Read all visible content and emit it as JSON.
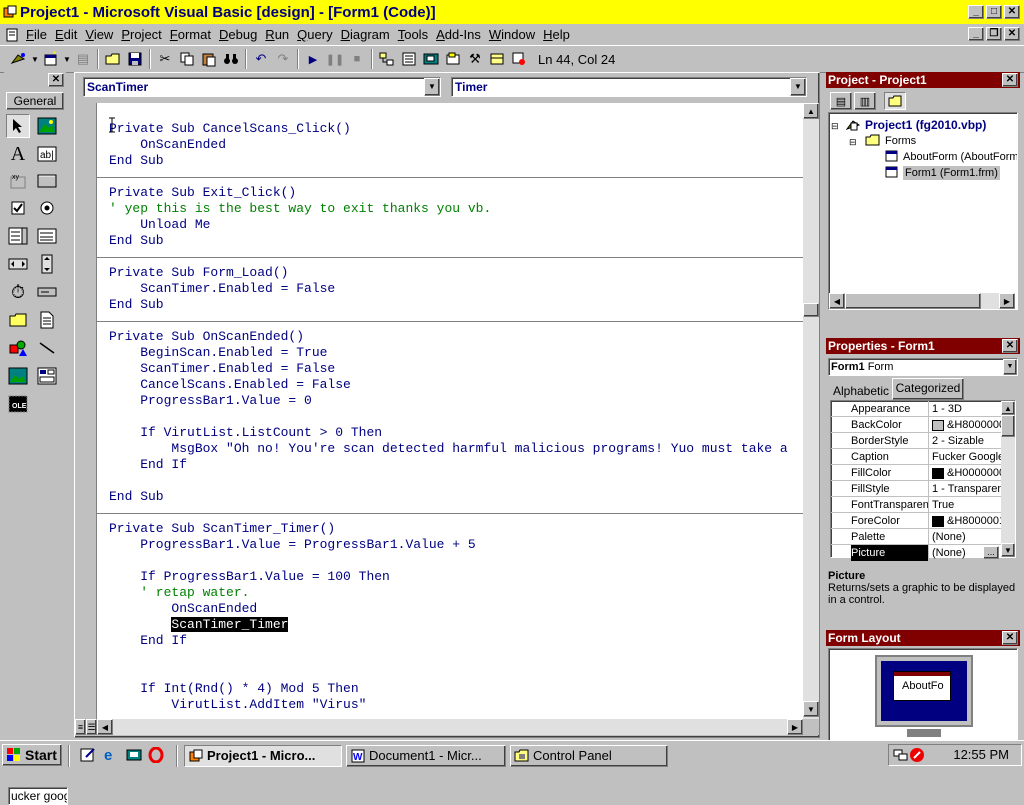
{
  "window": {
    "title": "Project1 - Microsoft Visual Basic [design] - [Form1 (Code)]"
  },
  "menu": {
    "items": [
      "File",
      "Edit",
      "View",
      "Project",
      "Format",
      "Debug",
      "Run",
      "Query",
      "Diagram",
      "Tools",
      "Add-Ins",
      "Window",
      "Help"
    ]
  },
  "toolbar": {
    "cursor_position": "Ln 44, Col 24"
  },
  "toolbox": {
    "tab_label": "General",
    "bottom_text": "ucker googl",
    "close": "✕"
  },
  "code_window": {
    "object_combo": "ScanTimer",
    "procedure_combo": "Timer",
    "lines": [
      {
        "text": "Private Sub CancelScans_Click()",
        "kind": "code"
      },
      {
        "text": "    OnScanEnded",
        "kind": "code"
      },
      {
        "text": "End Sub",
        "kind": "code"
      },
      {
        "text": "",
        "kind": "code"
      },
      {
        "text": "Private Sub Exit_Click()",
        "kind": "code"
      },
      {
        "text": "' yep this is the best way to exit thanks you vb.",
        "kind": "comment"
      },
      {
        "text": "    Unload Me",
        "kind": "code"
      },
      {
        "text": "End Sub",
        "kind": "code"
      },
      {
        "text": "",
        "kind": "code"
      },
      {
        "text": "Private Sub Form_Load()",
        "kind": "code"
      },
      {
        "text": "    ScanTimer.Enabled = False",
        "kind": "code"
      },
      {
        "text": "End Sub",
        "kind": "code"
      },
      {
        "text": "",
        "kind": "code"
      },
      {
        "text": "Private Sub OnScanEnded()",
        "kind": "code"
      },
      {
        "text": "    BeginScan.Enabled = True",
        "kind": "code"
      },
      {
        "text": "    ScanTimer.Enabled = False",
        "kind": "code"
      },
      {
        "text": "    CancelScans.Enabled = False",
        "kind": "code"
      },
      {
        "text": "    ProgressBar1.Value = 0",
        "kind": "code"
      },
      {
        "text": "",
        "kind": "code"
      },
      {
        "text": "    If VirutList.ListCount > 0 Then",
        "kind": "code"
      },
      {
        "text": "        MsgBox \"Oh no! You're scan detected harmful malicious programs! Yuo must take a",
        "kind": "code"
      },
      {
        "text": "    End If",
        "kind": "code"
      },
      {
        "text": "",
        "kind": "code"
      },
      {
        "text": "End Sub",
        "kind": "code"
      },
      {
        "text": "",
        "kind": "code"
      },
      {
        "text": "Private Sub ScanTimer_Timer()",
        "kind": "code"
      },
      {
        "text": "    ProgressBar1.Value = ProgressBar1.Value + 5",
        "kind": "code"
      },
      {
        "text": "",
        "kind": "code"
      },
      {
        "text": "    If ProgressBar1.Value = 100 Then",
        "kind": "code"
      },
      {
        "text": "    ' retap water.",
        "kind": "comment"
      },
      {
        "text": "        OnScanEnded",
        "kind": "code"
      },
      {
        "text": "        ScanTimer_Timer",
        "kind": "selected"
      },
      {
        "text": "    End If",
        "kind": "code"
      },
      {
        "text": "",
        "kind": "code"
      },
      {
        "text": "",
        "kind": "code"
      },
      {
        "text": "    If Int(Rnd() * 4) Mod 5 Then",
        "kind": "code"
      },
      {
        "text": "        VirutList.AddItem \"Virus\"",
        "kind": "code"
      }
    ]
  },
  "project_explorer": {
    "title": "Project - Project1",
    "root": "Project1 (fg2010.vbp)",
    "folder": "Forms",
    "items": [
      "AboutForm (AboutForm",
      "Form1 (Form1.frm)"
    ]
  },
  "properties": {
    "title": "Properties - Form1",
    "object_name": "Form1",
    "object_type": "Form",
    "tabs": [
      "Alphabetic",
      "Categorized"
    ],
    "rows": [
      {
        "name": "Appearance",
        "value": "1 - 3D"
      },
      {
        "name": "BackColor",
        "value": "&H8000000",
        "swatch": "#c0c0c0"
      },
      {
        "name": "BorderStyle",
        "value": "2 - Sizable"
      },
      {
        "name": "Caption",
        "value": "Fucker Google"
      },
      {
        "name": "FillColor",
        "value": "&H0000000",
        "swatch": "#000000"
      },
      {
        "name": "FillStyle",
        "value": "1 - Transparen"
      },
      {
        "name": "FontTransparen",
        "value": "True"
      },
      {
        "name": "ForeColor",
        "value": "&H8000001",
        "swatch": "#000000"
      },
      {
        "name": "Palette",
        "value": "(None)"
      },
      {
        "name": "Picture",
        "value": "(None)",
        "selected": true
      }
    ],
    "desc_title": "Picture",
    "desc_text": "Returns/sets a graphic to be displayed in a control."
  },
  "form_layout": {
    "title": "Form Layout",
    "form_label": "AboutFo"
  },
  "taskbar": {
    "start": "Start",
    "tasks": [
      "Project1 - Micro...",
      "Document1 - Micr...",
      "Control Panel"
    ],
    "clock": "12:55 PM"
  },
  "colors": {
    "title_bg": "#ffff00",
    "title_text": "#000080",
    "pane_title_bg": "#800000",
    "code_text": "#000080",
    "comment_text": "#008000",
    "face": "#c0c0c0"
  }
}
